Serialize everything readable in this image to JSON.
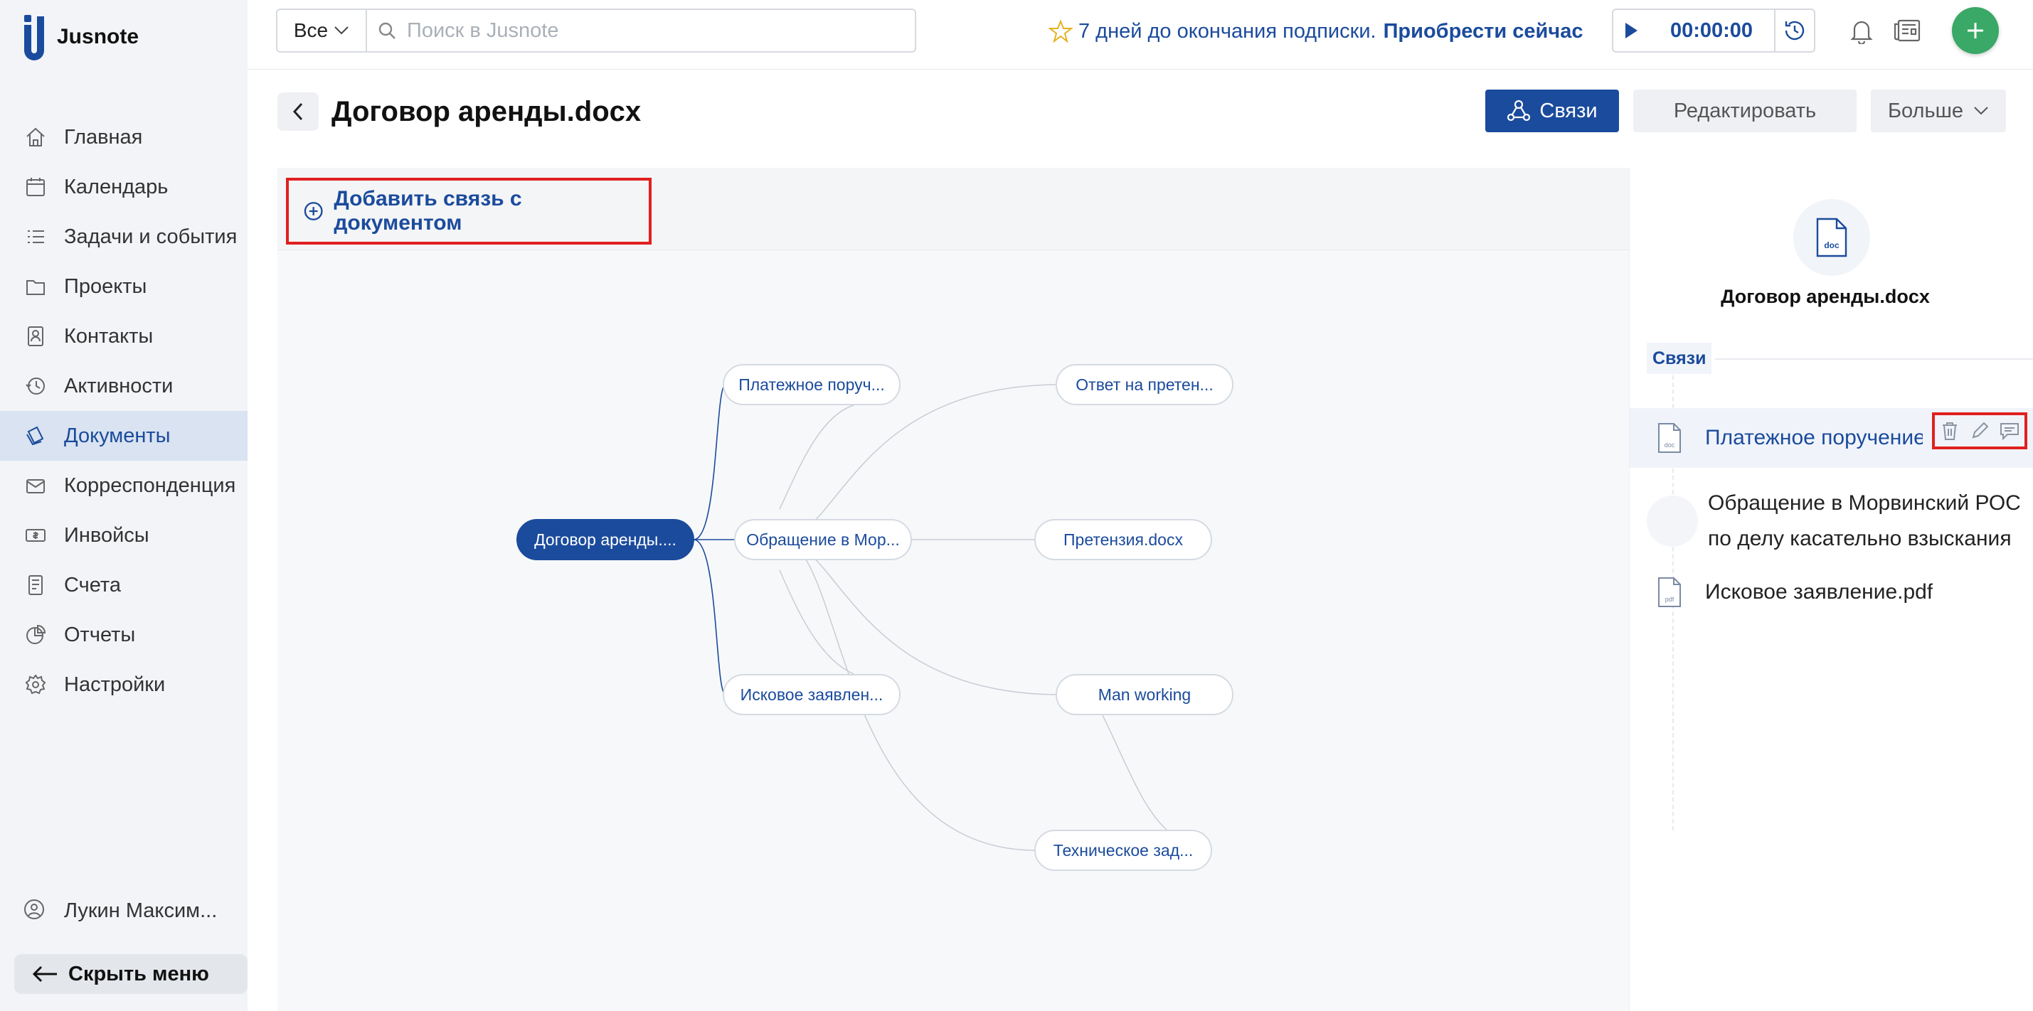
{
  "app": {
    "name": "Jusnote"
  },
  "sidebar": {
    "items": [
      {
        "label": "Главная",
        "icon": "home-icon"
      },
      {
        "label": "Календарь",
        "icon": "calendar-icon"
      },
      {
        "label": "Задачи и события",
        "icon": "tasks-icon"
      },
      {
        "label": "Проекты",
        "icon": "projects-icon"
      },
      {
        "label": "Контакты",
        "icon": "contacts-icon"
      },
      {
        "label": "Активности",
        "icon": "activity-icon"
      },
      {
        "label": "Документы",
        "icon": "documents-icon",
        "active": true
      },
      {
        "label": "Корреспонденция",
        "icon": "mail-icon"
      },
      {
        "label": "Инвойсы",
        "icon": "invoice-icon"
      },
      {
        "label": "Счета",
        "icon": "accounts-icon"
      },
      {
        "label": "Отчеты",
        "icon": "reports-icon"
      },
      {
        "label": "Настройки",
        "icon": "settings-icon"
      }
    ],
    "user": "Лукин Максим...",
    "hide_menu": "Скрыть меню"
  },
  "topbar": {
    "scope": "Все",
    "search_placeholder": "Поиск в Jusnote",
    "subscription_days": "7 дней до окончания подписки.",
    "subscription_buy": "Приобрести сейчас",
    "timer": "00:00:00"
  },
  "document": {
    "title": "Договор аренды.docx",
    "links_button": "Связи",
    "edit_button": "Редактировать",
    "more_button": "Больше"
  },
  "graph": {
    "add_link": "Добавить связь с документом",
    "nodes": {
      "root": "Договор аренды....",
      "payment": "Платежное поруч...",
      "appeal": "Обращение в Мор...",
      "claim_stmt": "Исковое заявлен...",
      "claim_reply": "Ответ на претен...",
      "claim": "Претензия.docx",
      "man_working": "Man working",
      "tech_task": "Техническое зад..."
    }
  },
  "panel": {
    "doc_icon_label": "doc",
    "title": "Договор аренды.docx",
    "section": "Связи",
    "items": [
      {
        "text": "Платежное поручение",
        "icon_label": "doc"
      },
      {
        "line1": "Обращение в Морвинский РОСП",
        "line2": "по делу касательно взыскания"
      },
      {
        "text": "Исковое заявление.pdf",
        "icon_label": "pdf"
      }
    ]
  },
  "colors": {
    "accent": "#1b4b9c",
    "highlight_border": "#e02020",
    "fab": "#3aa866",
    "star": "#e6b020"
  }
}
